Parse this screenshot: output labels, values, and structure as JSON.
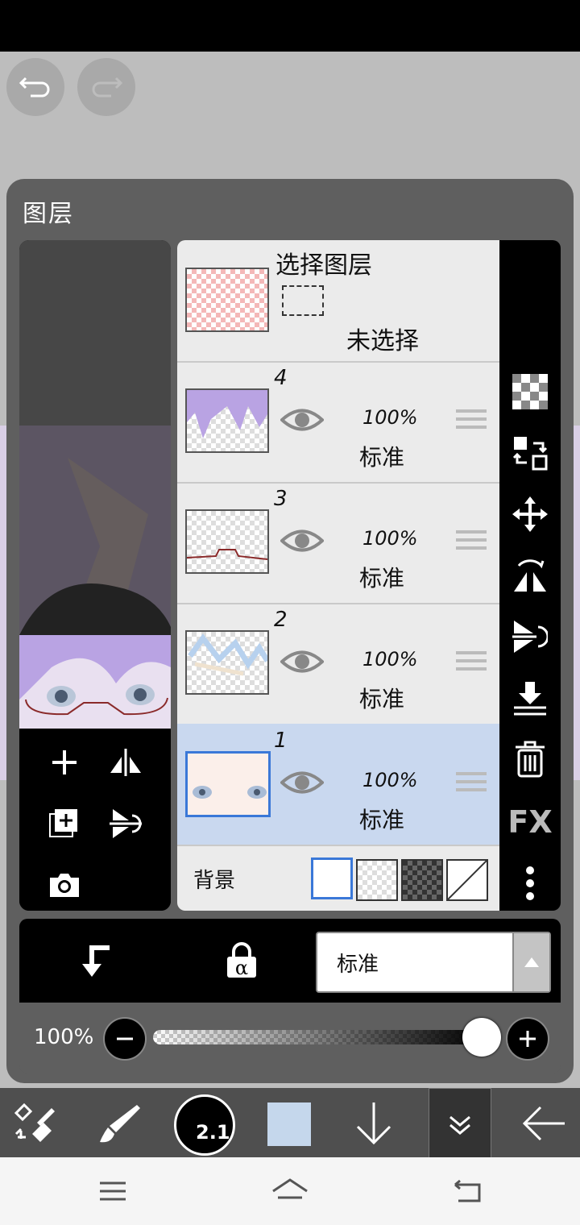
{
  "panel": {
    "title": "图层",
    "selection_layer": {
      "title": "选择图层",
      "status": "未选择"
    },
    "layers": [
      {
        "number": "4",
        "opacity": "100%",
        "blend": "标准",
        "selected": false
      },
      {
        "number": "3",
        "opacity": "100%",
        "blend": "标准",
        "selected": false
      },
      {
        "number": "2",
        "opacity": "100%",
        "blend": "标准",
        "selected": false
      },
      {
        "number": "1",
        "opacity": "100%",
        "blend": "标准",
        "selected": true
      }
    ],
    "background_label": "背景",
    "blend_mode_value": "标准",
    "opacity_label": "100%",
    "opacity_value": 1.0,
    "right_tools": [
      "checker-icon",
      "layer-swap-icon",
      "move-icon",
      "flip-horizontal-icon",
      "flip-vertical-icon",
      "merge-down-icon",
      "trash-icon",
      "fx-icon",
      "more-icon"
    ],
    "fx_label": "FX"
  },
  "toolbar": {
    "brush_size": "2.1",
    "current_color": "#c5d7ec"
  },
  "colors": {
    "selected_row": "#c9d8ef",
    "accent_blue": "#3a78d8"
  }
}
